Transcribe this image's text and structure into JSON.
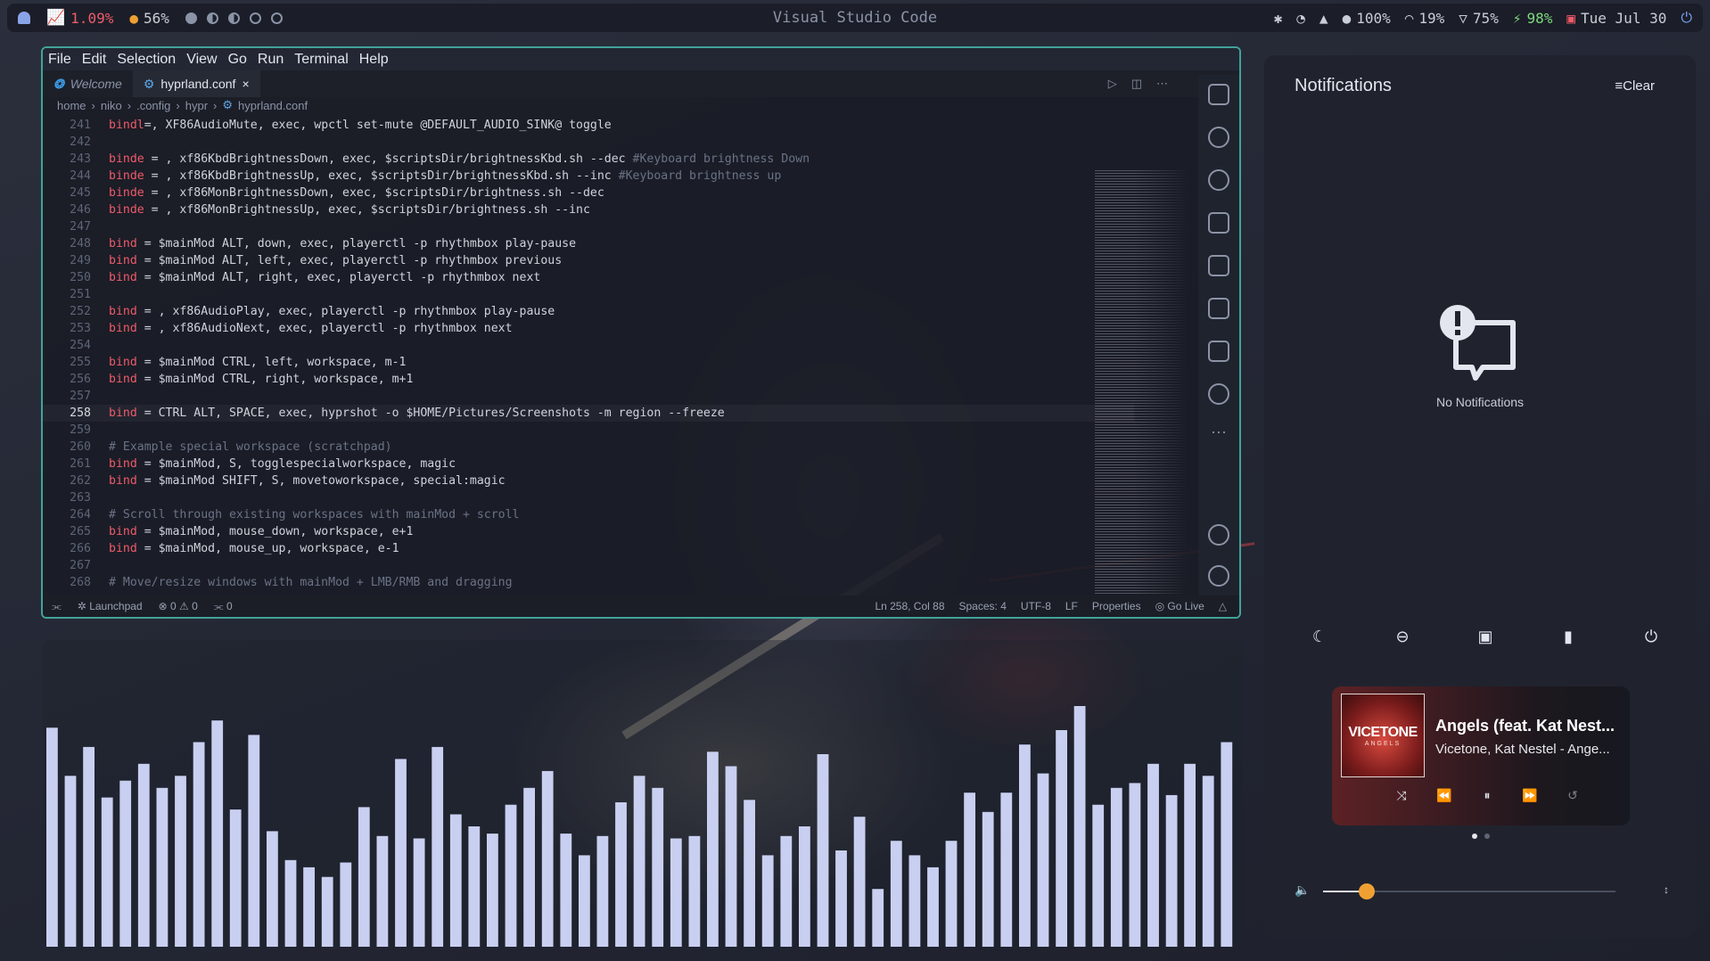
{
  "topbar": {
    "cpu": "1.09%",
    "memory": "56%",
    "window_title": "Visual Studio Code",
    "volume": "100%",
    "headset_battery": "19%",
    "wifi_strength": "75%",
    "battery": "98%",
    "date": "Tue Jul 30",
    "icons": [
      "ghost-icon",
      "chart-icon",
      "memory-icon",
      "workspace-dots",
      "bluetooth-icon",
      "wifi-icon",
      "bell-icon",
      "volume-icon",
      "headset-icon",
      "battery-icon",
      "calendar-icon",
      "power-icon"
    ]
  },
  "vscode": {
    "menu": [
      "File",
      "Edit",
      "Selection",
      "View",
      "Go",
      "Run",
      "Terminal",
      "Help"
    ],
    "tabs": [
      {
        "label": "Welcome",
        "active": false
      },
      {
        "label": "hyprland.conf",
        "active": true,
        "close": "×"
      }
    ],
    "breadcrumb": [
      "home",
      "niko",
      ".config",
      "hypr",
      "hyprland.conf"
    ],
    "lines": [
      {
        "n": "241",
        "t": "bindl=, XF86AudioMute, exec, wpctl set-mute @DEFAULT_AUDIO_SINK@ toggle"
      },
      {
        "n": "242",
        "t": ""
      },
      {
        "n": "243",
        "t": "binde = , xf86KbdBrightnessDown, exec, $scriptsDir/brightnessKbd.sh --dec ",
        "c": "#Keyboard brightness Down"
      },
      {
        "n": "244",
        "t": "binde = , xf86KbdBrightnessUp, exec, $scriptsDir/brightnessKbd.sh --inc ",
        "c": "#Keyboard brightness up"
      },
      {
        "n": "245",
        "t": "binde = , xf86MonBrightnessDown, exec, $scriptsDir/brightness.sh --dec"
      },
      {
        "n": "246",
        "t": "binde = , xf86MonBrightnessUp, exec, $scriptsDir/brightness.sh --inc"
      },
      {
        "n": "247",
        "t": ""
      },
      {
        "n": "248",
        "t": "bind = $mainMod ALT, down, exec, playerctl -p rhythmbox play-pause"
      },
      {
        "n": "249",
        "t": "bind = $mainMod ALT, left, exec, playerctl -p rhythmbox previous"
      },
      {
        "n": "250",
        "t": "bind = $mainMod ALT, right, exec, playerctl -p rhythmbox next"
      },
      {
        "n": "251",
        "t": ""
      },
      {
        "n": "252",
        "t": "bind = , xf86AudioPlay, exec, playerctl -p rhythmbox play-pause"
      },
      {
        "n": "253",
        "t": "bind = , xf86AudioNext, exec, playerctl -p rhythmbox next"
      },
      {
        "n": "254",
        "t": ""
      },
      {
        "n": "255",
        "t": "bind = $mainMod CTRL, left, workspace, m-1"
      },
      {
        "n": "256",
        "t": "bind = $mainMod CTRL, right, workspace, m+1"
      },
      {
        "n": "257",
        "t": ""
      },
      {
        "n": "258",
        "t": "bind = CTRL ALT, SPACE, exec, hyprshot -o $HOME/Pictures/Screenshots -m region --freeze",
        "cur": true
      },
      {
        "n": "259",
        "t": ""
      },
      {
        "n": "260",
        "t": "",
        "c": "# Example special workspace (scratchpad)"
      },
      {
        "n": "261",
        "t": "bind = $mainMod, S, togglespecialworkspace, magic"
      },
      {
        "n": "262",
        "t": "bind = $mainMod SHIFT, S, movetoworkspace, special:magic"
      },
      {
        "n": "263",
        "t": ""
      },
      {
        "n": "264",
        "t": "",
        "c": "# Scroll through existing workspaces with mainMod + scroll"
      },
      {
        "n": "265",
        "t": "bind = $mainMod, mouse_down, workspace, e+1"
      },
      {
        "n": "266",
        "t": "bind = $mainMod, mouse_up, workspace, e-1"
      },
      {
        "n": "267",
        "t": ""
      },
      {
        "n": "268",
        "t": "",
        "c": "# Move/resize windows with mainMod + LMB/RMB and dragging"
      }
    ],
    "status": {
      "remote": "Launchpad",
      "errors": "0",
      "warnings": "0",
      "ports": "0",
      "position": "Ln 258, Col 88",
      "spaces": "Spaces: 4",
      "encoding": "UTF-8",
      "eol": "LF",
      "language": "Properties",
      "golive": "Go Live"
    }
  },
  "visualizer": {
    "levels": [
      0.91,
      0.71,
      0.83,
      0.62,
      0.69,
      0.76,
      0.66,
      0.71,
      0.85,
      0.94,
      0.57,
      0.88,
      0.48,
      0.36,
      0.33,
      0.29,
      0.35,
      0.58,
      0.46,
      0.78,
      0.45,
      0.83,
      0.55,
      0.5,
      0.47,
      0.59,
      0.66,
      0.73,
      0.47,
      0.38,
      0.46,
      0.6,
      0.71,
      0.66,
      0.45,
      0.46,
      0.81,
      0.75,
      0.61,
      0.38,
      0.46,
      0.5,
      0.8,
      0.4,
      0.54,
      0.24,
      0.44,
      0.38,
      0.33,
      0.44,
      0.64,
      0.56,
      0.64,
      0.84,
      0.72,
      0.9,
      1.0,
      0.59,
      0.66,
      0.68,
      0.76,
      0.63,
      0.76,
      0.71,
      0.85
    ]
  },
  "notifications": {
    "title": "Notifications",
    "clear_label": "Clear",
    "empty_text": "No Notifications",
    "quick_actions": [
      "moon-icon",
      "dnd-icon",
      "camera-icon",
      "video-icon",
      "power-icon"
    ],
    "media": {
      "cover_title": "VICETONE",
      "cover_subtitle": "ANGELS",
      "title": "Angels (feat. Kat Nest...",
      "artist": "Vicetone, Kat Nestel - Ange...",
      "controls": [
        "shuffle-icon",
        "previous-icon",
        "pause-icon",
        "next-icon",
        "repeat-icon"
      ]
    },
    "pager": {
      "pages": 2,
      "current": 1
    },
    "volume_level": 0.15
  }
}
